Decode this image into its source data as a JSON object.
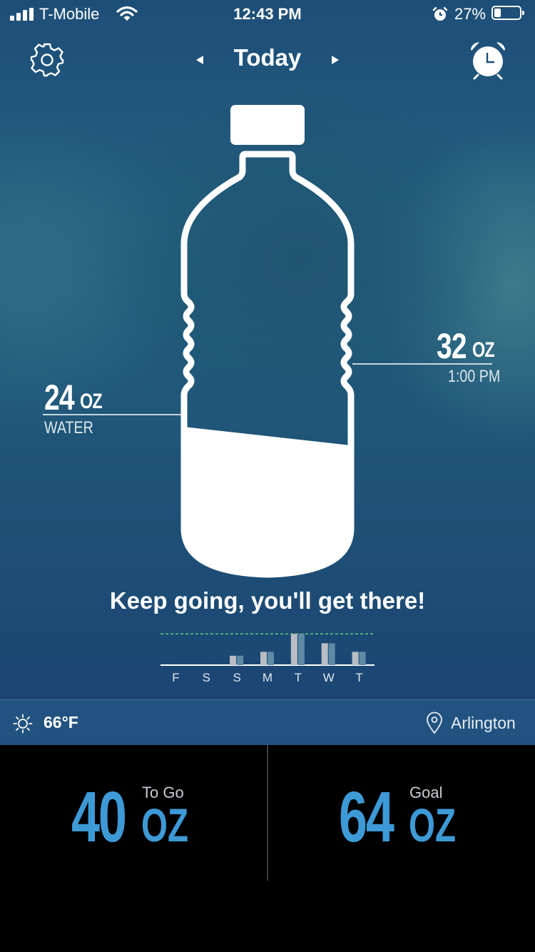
{
  "status_bar": {
    "carrier": "T-Mobile",
    "time": "12:43 PM",
    "battery": "27%",
    "battery_level": 0.27
  },
  "nav": {
    "title": "Today"
  },
  "bottle": {
    "current_amount": "24",
    "current_unit": "OZ",
    "current_label": "WATER",
    "target_amount": "32",
    "target_unit": "OZ",
    "target_time": "1:00 PM",
    "fill_fraction": 0.375
  },
  "message": "Keep going, you'll get there!",
  "chart_data": {
    "type": "bar",
    "categories": [
      "F",
      "S",
      "S",
      "M",
      "T",
      "W",
      "T"
    ],
    "series": [
      {
        "values": [
          0,
          0,
          12,
          17,
          40,
          28,
          17
        ]
      },
      {
        "values": [
          0,
          0,
          12,
          17,
          40,
          28,
          17
        ]
      }
    ],
    "goal_line": 40,
    "ylim": [
      0,
      42
    ],
    "grid": false,
    "colors": [
      "#b9bec4",
      "#5f8aa6"
    ],
    "goal_color": "#5fd07a"
  },
  "weather": {
    "temperature": "66°F",
    "location": "Arlington"
  },
  "stats": {
    "to_go_value": "40",
    "to_go_unit": "OZ",
    "to_go_label": "To Go",
    "goal_value": "64",
    "goal_unit": "OZ",
    "goal_label": "Goal"
  },
  "icons": {
    "settings": "gear-icon",
    "alarm": "alarm-clock-icon",
    "weather": "sun-icon",
    "location": "location-pin-icon"
  }
}
